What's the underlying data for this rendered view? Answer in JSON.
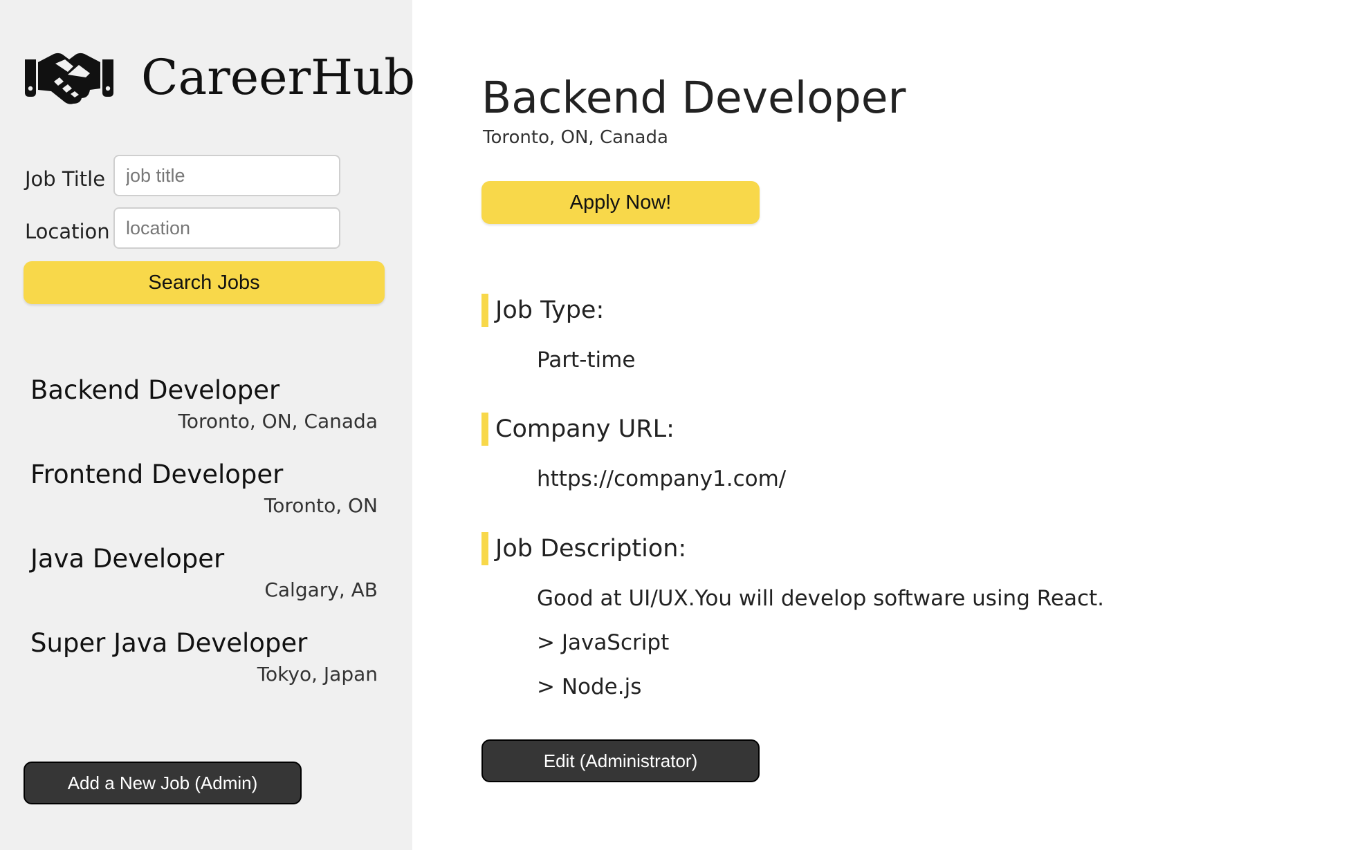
{
  "brand": {
    "name": "CareerHub",
    "logo_icon": "handshake-icon"
  },
  "search": {
    "title_label": "Job Title",
    "title_placeholder": "job title",
    "title_value": "",
    "location_label": "Location",
    "location_placeholder": "location",
    "location_value": "",
    "button_label": "Search Jobs"
  },
  "jobs": [
    {
      "title": "Backend Developer",
      "location": "Toronto, ON, Canada"
    },
    {
      "title": "Frontend Developer",
      "location": "Toronto, ON"
    },
    {
      "title": "Java Developer",
      "location": "Calgary, AB"
    },
    {
      "title": "Super Java Developer",
      "location": "Tokyo, Japan"
    }
  ],
  "sidebar": {
    "add_job_label": "Add a New Job (Admin)"
  },
  "detail": {
    "title": "Backend Developer",
    "location": "Toronto, ON, Canada",
    "apply_label": "Apply Now!",
    "job_type_label": "Job Type:",
    "job_type": "Part-time",
    "company_url_label": "Company URL:",
    "company_url": "https://company1.com/",
    "description_label": "Job Description:",
    "description_lines": [
      "Good at UI/UX.You will develop software using React.",
      "> JavaScript",
      "> Node.js"
    ],
    "edit_label": "Edit (Administrator)"
  },
  "colors": {
    "accent_yellow": "#f8d84a",
    "sidebar_bg": "#f0f0f0",
    "dark_button": "#363636"
  }
}
